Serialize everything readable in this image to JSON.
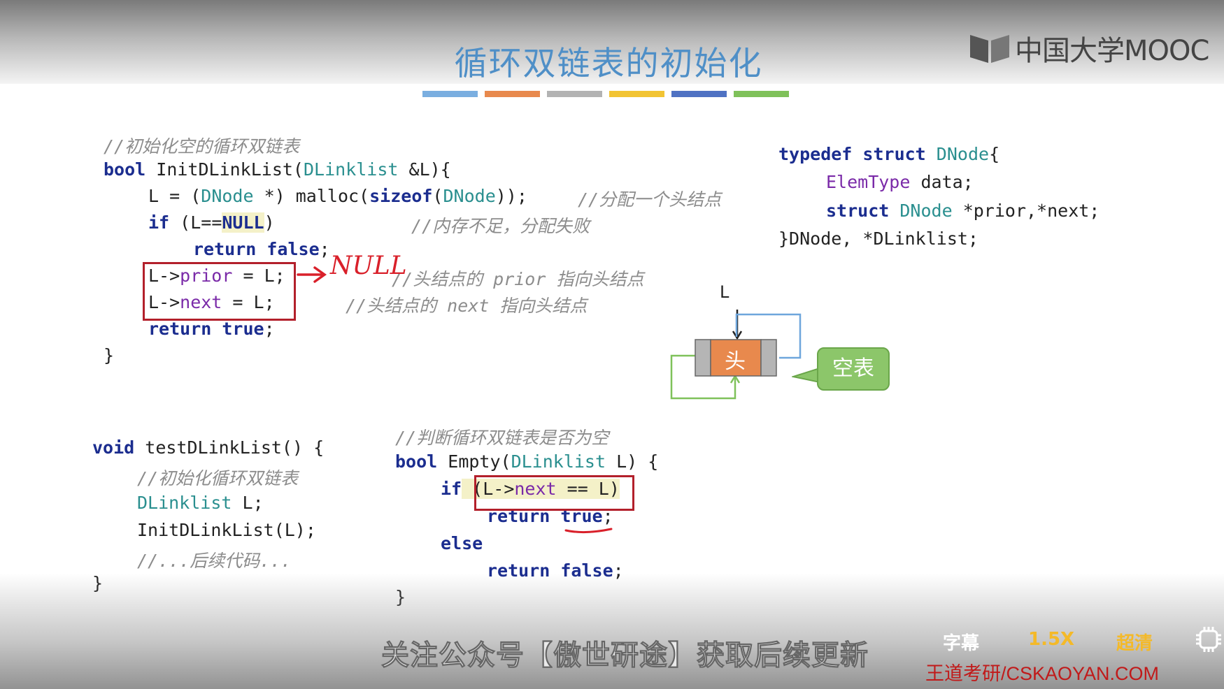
{
  "slide": {
    "title": "循环双链表的初始化",
    "colorbar": [
      "#7aaee0",
      "#e8894d",
      "#b3b3b3",
      "#f2c433",
      "#4f72c3",
      "#7fc15a"
    ]
  },
  "logo": {
    "text": "中国大学MOOC"
  },
  "typedef": {
    "line1_kw1": "typedef",
    "line1_kw2": "struct",
    "line1_type": "DNode",
    "line1_brace": "{",
    "line2_type": "ElemType",
    "line2_rest": " data;",
    "line3_kw": "struct",
    "line3_type": "DNode",
    "line3_rest": " *prior,*next;",
    "line4": "}DNode, *DLinklist;"
  },
  "init_func": {
    "comment": "//初始化空的循环双链表",
    "sig_kw": "bool",
    "sig_name": " InitDLinkList(",
    "sig_type": "DLinklist",
    "sig_rest": " &L){",
    "l1_pre": "L = (",
    "l1_type": "DNode",
    "l1_mid": " *) malloc(",
    "l1_kw": "sizeof",
    "l1_paren": "(",
    "l1_type2": "DNode",
    "l1_end": "));",
    "l1_comment": "//分配一个头结点",
    "l2_kw": "if",
    "l2_pre": " (L==",
    "l2_null": "NULL",
    "l2_end": ")",
    "l2_comment": "//内存不足，分配失败",
    "l3_kw1": "return",
    "l3_kw2": "false",
    "l3_end": ";",
    "l4_pre": "L->",
    "l4_fld": "prior",
    "l4_end": " = L;",
    "l4_comment": "//头结点的 prior 指向头结点",
    "l5_pre": "L->",
    "l5_fld": "next",
    "l5_end": " = L;",
    "l5_comment": "//头结点的 next 指向头结点",
    "l6_kw1": "return",
    "l6_kw2": "true",
    "l6_end": ";",
    "close": "}"
  },
  "annotation": {
    "null_note": "NULL"
  },
  "diagram": {
    "pointer_label": "L",
    "head_label": "头",
    "bubble_label": "空表"
  },
  "test_func": {
    "sig_kw": "void",
    "sig_rest": " testDLinkList() {",
    "comment1": "//初始化循环双链表",
    "l2_type": "DLinklist",
    "l2_rest": " L;",
    "l3": "InitDLinkList(L);",
    "comment2": "//...后续代码...",
    "close": "}"
  },
  "empty_func": {
    "comment": "//判断循环双链表是否为空",
    "sig_kw": "bool",
    "sig_name": " Empty(",
    "sig_type": "DLinklist",
    "sig_rest": " L) {",
    "if_kw": "if",
    "cond_pre": " (L->",
    "cond_fld": "next",
    "cond_end": " == L)",
    "ret1_kw": "return",
    "ret1_val": "true",
    "ret1_end": ";",
    "else_kw": "else",
    "ret2_kw": "return",
    "ret2_val": "false",
    "ret2_end": ";",
    "close": "}"
  },
  "player": {
    "subtitle": "关注公众号【傲世研途】获取后续更新",
    "caption_btn": "字幕",
    "speed_btn": "1.5X",
    "quality_btn": "超清",
    "settings_icon": "gear-icon",
    "watermark": "王道考研/CSKAOYAN.COM"
  }
}
